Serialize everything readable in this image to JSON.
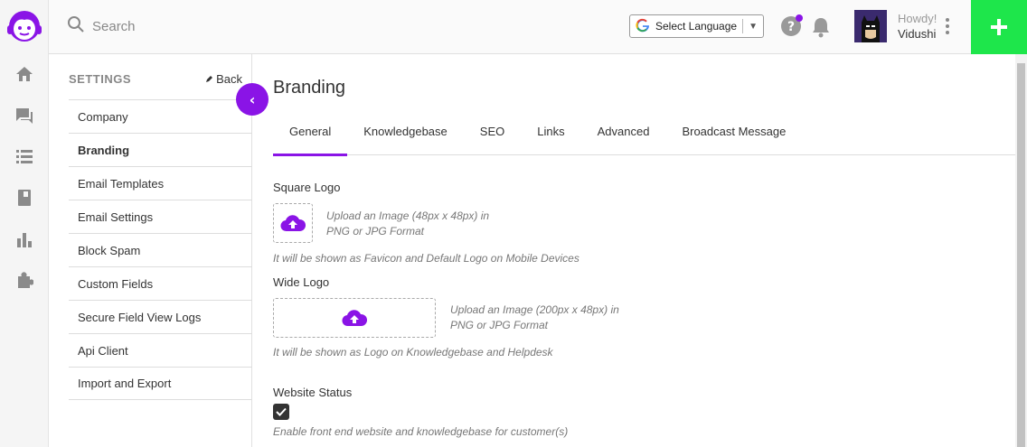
{
  "colors": {
    "accent": "#8a14e6",
    "add_button": "#1ee64b"
  },
  "search": {
    "placeholder": "Search"
  },
  "language": {
    "label": "Select Language"
  },
  "user": {
    "greeting": "Howdy!",
    "name": "Vidushi"
  },
  "rail": {
    "icons": [
      "home-icon",
      "chat-icon",
      "list-icon",
      "book-icon",
      "bar-chart-icon",
      "puzzle-icon"
    ]
  },
  "settings": {
    "title": "SETTINGS",
    "back_label": "Back",
    "items": [
      {
        "label": "Company"
      },
      {
        "label": "Branding"
      },
      {
        "label": "Email Templates"
      },
      {
        "label": "Email Settings"
      },
      {
        "label": "Block Spam"
      },
      {
        "label": "Custom Fields"
      },
      {
        "label": "Secure Field View Logs"
      },
      {
        "label": "Api Client"
      },
      {
        "label": "Import and Export"
      }
    ],
    "active": "Branding"
  },
  "main": {
    "title": "Branding",
    "tabs": [
      {
        "label": "General"
      },
      {
        "label": "Knowledgebase"
      },
      {
        "label": "SEO"
      },
      {
        "label": "Links"
      },
      {
        "label": "Advanced"
      },
      {
        "label": "Broadcast Message"
      }
    ],
    "active_tab": "General",
    "square_logo": {
      "label": "Square Logo",
      "upload_line1": "Upload an Image (48px x 48px) in",
      "upload_line2": "PNG or JPG Format",
      "hint": "It will be shown as Favicon and Default Logo on Mobile Devices"
    },
    "wide_logo": {
      "label": "Wide Logo",
      "upload_line1": "Upload an Image (200px x 48px) in",
      "upload_line2": "PNG or JPG Format",
      "hint": "It will be shown as Logo on Knowledgebase and Helpdesk"
    },
    "website_status": {
      "label": "Website Status",
      "checked": true,
      "hint": "Enable front end website and knowledgebase for customer(s)"
    }
  }
}
